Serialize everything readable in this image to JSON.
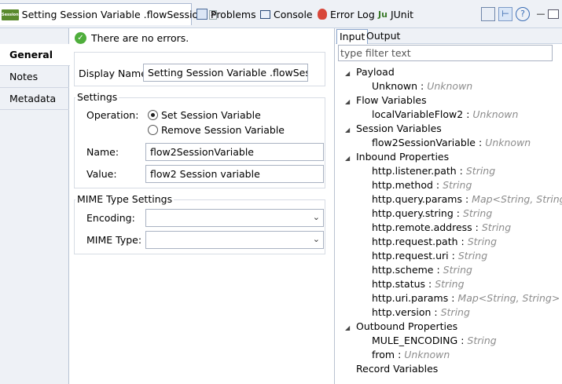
{
  "tabs": {
    "active_label": "Setting Session Variable .flowSession",
    "problems": "Problems",
    "console": "Console",
    "error_log": "Error Log",
    "junit": "JUnit"
  },
  "sidebar": {
    "items": [
      {
        "label": "General"
      },
      {
        "label": "Notes"
      },
      {
        "label": "Metadata"
      }
    ]
  },
  "status": {
    "message": "There are no errors."
  },
  "form": {
    "display_name_label": "Display Name:",
    "display_name_value": "Setting Session Variable .flowSession",
    "settings_title": "Settings",
    "operation_label": "Operation:",
    "op_set": "Set Session Variable",
    "op_remove": "Remove Session Variable",
    "name_label": "Name:",
    "name_value": "flow2SessionVariable",
    "value_label": "Value:",
    "value_value": "flow2 Session variable",
    "mime_title": "MIME Type Settings",
    "encoding_label": "Encoding:",
    "mime_type_label": "MIME Type:"
  },
  "right": {
    "tab_input": "Input",
    "tab_output": "Output",
    "filter_placeholder": "type filter text",
    "tree": [
      {
        "label": "Payload",
        "level": 0,
        "expanded": true
      },
      {
        "label": "Unknown",
        "type": "Unknown",
        "level": 1
      },
      {
        "label": "Flow Variables",
        "level": 0,
        "expanded": true
      },
      {
        "label": "localVariableFlow2",
        "type": "Unknown",
        "level": 1
      },
      {
        "label": "Session Variables",
        "level": 0,
        "expanded": true
      },
      {
        "label": "flow2SessionVariable",
        "type": "Unknown",
        "level": 1
      },
      {
        "label": "Inbound Properties",
        "level": 0,
        "expanded": true
      },
      {
        "label": "http.listener.path",
        "type": "String",
        "level": 1
      },
      {
        "label": "http.method",
        "type": "String",
        "level": 1
      },
      {
        "label": "http.query.params",
        "type": "Map<String, String>",
        "level": 1
      },
      {
        "label": "http.query.string",
        "type": "String",
        "level": 1
      },
      {
        "label": "http.remote.address",
        "type": "String",
        "level": 1
      },
      {
        "label": "http.request.path",
        "type": "String",
        "level": 1
      },
      {
        "label": "http.request.uri",
        "type": "String",
        "level": 1
      },
      {
        "label": "http.scheme",
        "type": "String",
        "level": 1
      },
      {
        "label": "http.status",
        "type": "String",
        "level": 1
      },
      {
        "label": "http.uri.params",
        "type": "Map<String, String>",
        "level": 1
      },
      {
        "label": "http.version",
        "type": "String",
        "level": 1
      },
      {
        "label": "Outbound Properties",
        "level": 0,
        "expanded": true
      },
      {
        "label": "MULE_ENCODING",
        "type": "String",
        "level": 1
      },
      {
        "label": "from",
        "type": "Unknown",
        "level": 1
      },
      {
        "label": "Record Variables",
        "level": 0,
        "expanded": false
      }
    ]
  }
}
